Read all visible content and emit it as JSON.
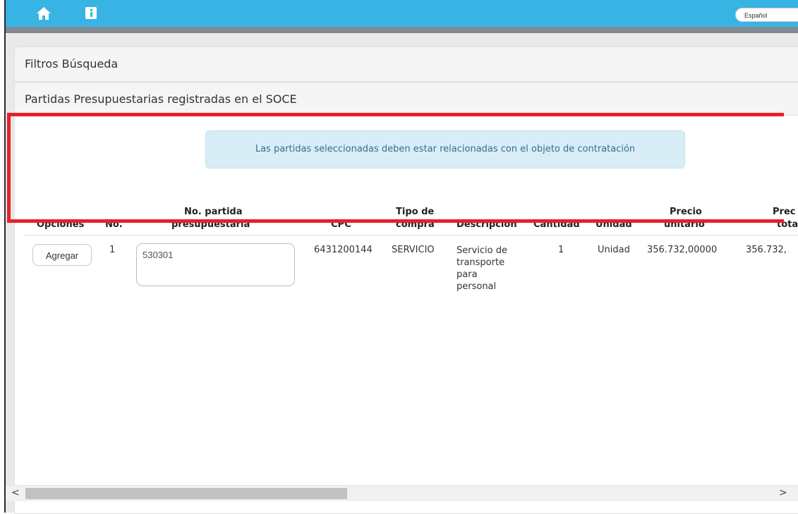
{
  "topbar": {
    "home_icon": "home-icon",
    "info_icon": "info-icon",
    "language": "Español",
    "accent": "#37b4e3"
  },
  "panels": {
    "filtros_title": "Filtros Búsqueda",
    "partidas_title": "Partidas Presupuestarias registradas en el SOCE"
  },
  "alert": {
    "text": "Las partidas seleccionadas deben estar relacionadas con el objeto de contratación"
  },
  "table": {
    "headers": {
      "opciones": "Opciones",
      "no": "No.",
      "partida_l1": "No. partida",
      "partida_l2": "presupuestaria",
      "cpc": "CPC",
      "tipo_l1": "Tipo de",
      "tipo_l2": "compra",
      "descripcion": "Descripción",
      "cantidad": "Cantidad",
      "unidad": "Unidad",
      "precio_unit_l1": "Precio",
      "precio_unit_l2": "unitario",
      "precio_total_l1": "Prec",
      "precio_total_l2": "tota"
    },
    "row": {
      "button_label": "Agregar",
      "no": "1",
      "partida": "530301",
      "cpc": "6431200144",
      "tipo": "SERVICIO",
      "descripcion_l1": "Servicio de",
      "descripcion_l2": "transporte",
      "descripcion_l3": "para",
      "descripcion_l4": "personal",
      "cantidad": "1",
      "unidad": "Unidad",
      "precio_unitario": "356.732,00000",
      "precio_total": "356.732,"
    }
  },
  "scrollbar": {
    "left_arrow": "<",
    "right_arrow": ">"
  }
}
